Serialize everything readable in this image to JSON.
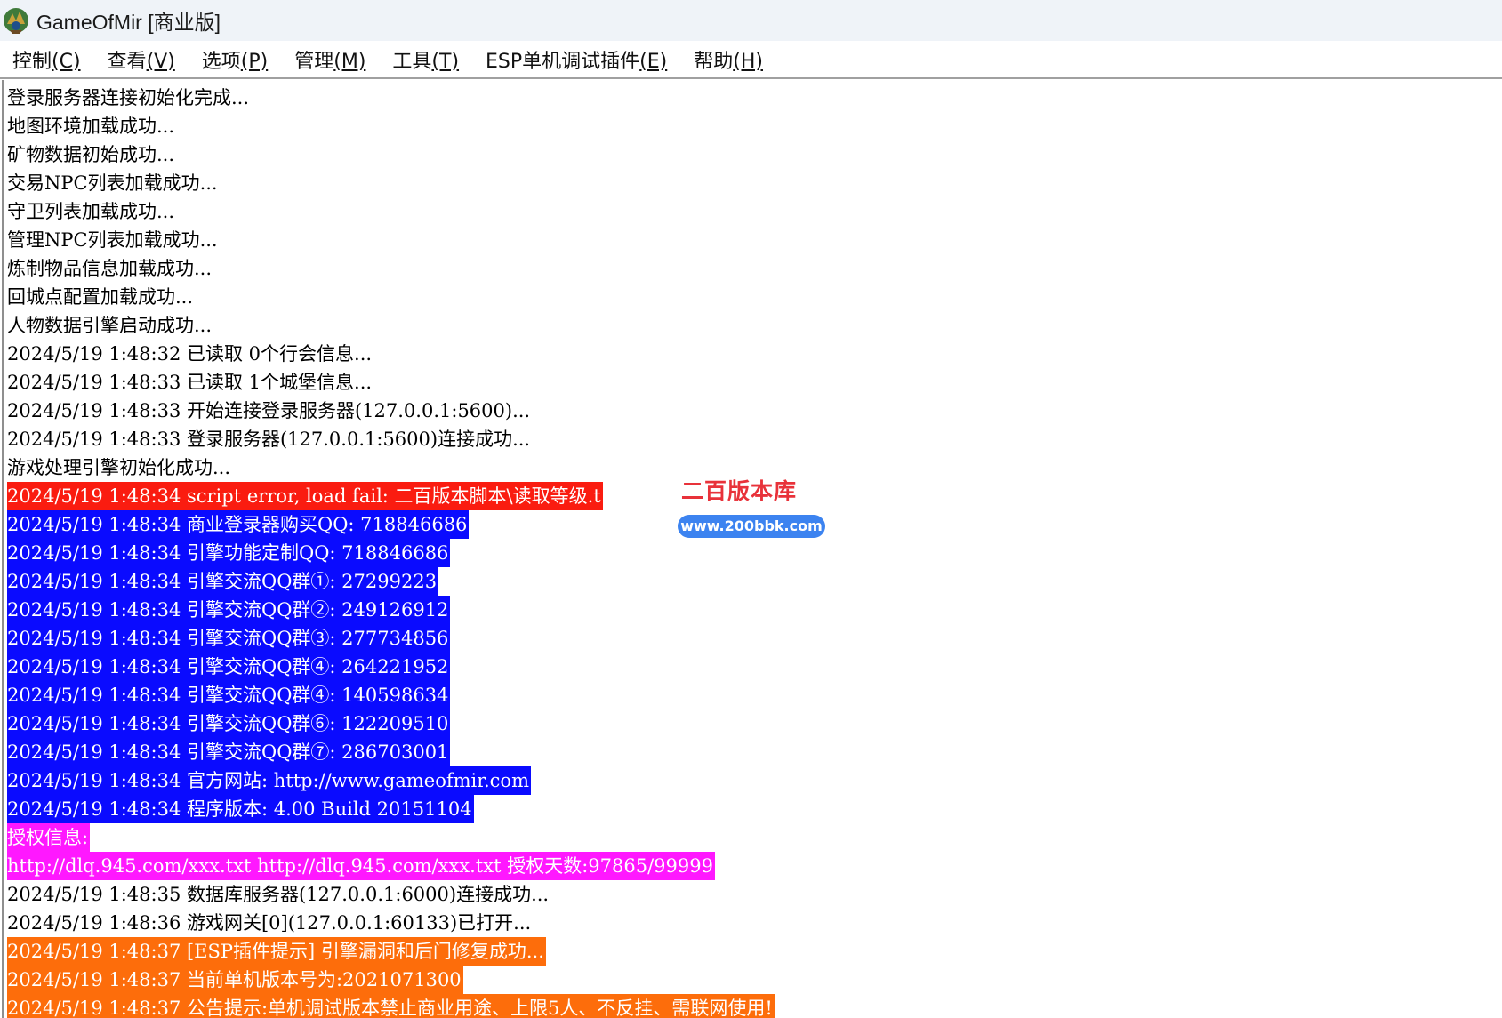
{
  "window": {
    "title": "GameOfMir [商业版]"
  },
  "menu": [
    {
      "label": "控制",
      "accel": "(C)"
    },
    {
      "label": "查看",
      "accel": "(V)"
    },
    {
      "label": "选项",
      "accel": "(P)"
    },
    {
      "label": "管理",
      "accel": "(M)"
    },
    {
      "label": "工具",
      "accel": "(T)"
    },
    {
      "label": "ESP单机调试插件",
      "accel": "(E)"
    },
    {
      "label": "帮助",
      "accel": "(H)"
    }
  ],
  "log": [
    {
      "text": "登录服务器连接初始化完成...",
      "style": "plain"
    },
    {
      "text": "地图环境加载成功...",
      "style": "plain"
    },
    {
      "text": "矿物数据初始成功...",
      "style": "plain"
    },
    {
      "text": "交易NPC列表加载成功...",
      "style": "plain"
    },
    {
      "text": "守卫列表加载成功...",
      "style": "plain"
    },
    {
      "text": "管理NPC列表加载成功...",
      "style": "plain"
    },
    {
      "text": "炼制物品信息加载成功...",
      "style": "plain"
    },
    {
      "text": "回城点配置加载成功...",
      "style": "plain"
    },
    {
      "text": "人物数据引擎启动成功...",
      "style": "plain"
    },
    {
      "text": "2024/5/19 1:48:32 已读取 0个行会信息...",
      "style": "plain"
    },
    {
      "text": "2024/5/19 1:48:33 已读取 1个城堡信息...",
      "style": "plain"
    },
    {
      "text": "2024/5/19 1:48:33 开始连接登录服务器(127.0.0.1:5600)...",
      "style": "plain"
    },
    {
      "text": "2024/5/19 1:48:33 登录服务器(127.0.0.1:5600)连接成功...",
      "style": "plain"
    },
    {
      "text": "游戏处理引擎初始化成功...",
      "style": "plain"
    },
    {
      "text": "2024/5/19 1:48:34 script error, load fail: 二百版本脚本\\读取等级.t",
      "style": "red"
    },
    {
      "text": "2024/5/19 1:48:34 商业登录器购买QQ: 718846686",
      "style": "blue"
    },
    {
      "text": "2024/5/19 1:48:34 引擎功能定制QQ: 718846686",
      "style": "blue"
    },
    {
      "text": "2024/5/19 1:48:34 引擎交流QQ群①: 27299223",
      "style": "blue"
    },
    {
      "text": "2024/5/19 1:48:34 引擎交流QQ群②: 249126912",
      "style": "blue"
    },
    {
      "text": "2024/5/19 1:48:34 引擎交流QQ群③: 277734856",
      "style": "blue"
    },
    {
      "text": "2024/5/19 1:48:34 引擎交流QQ群④: 264221952",
      "style": "blue"
    },
    {
      "text": "2024/5/19 1:48:34 引擎交流QQ群④: 140598634",
      "style": "blue"
    },
    {
      "text": "2024/5/19 1:48:34 引擎交流QQ群⑥: 122209510",
      "style": "blue"
    },
    {
      "text": "2024/5/19 1:48:34 引擎交流QQ群⑦: 286703001",
      "style": "blue"
    },
    {
      "text": "2024/5/19 1:48:34 官方网站: http://www.gameofmir.com",
      "style": "blue"
    },
    {
      "text": "2024/5/19 1:48:34 程序版本: 4.00 Build 20151104",
      "style": "blue"
    },
    {
      "text": "授权信息:    ",
      "style": "magenta"
    },
    {
      "text": "http://dlq.945.com/xxx.txt http://dlq.945.com/xxx.txt 授权天数:97865/99999",
      "style": "magenta"
    },
    {
      "text": "2024/5/19 1:48:35 数据库服务器(127.0.0.1:6000)连接成功...",
      "style": "plain"
    },
    {
      "text": "2024/5/19 1:48:36 游戏网关[0](127.0.0.1:60133)已打开...",
      "style": "plain"
    },
    {
      "text": "2024/5/19 1:48:37 [ESP插件提示] 引擎漏洞和后门修复成功...",
      "style": "orange"
    },
    {
      "text": "2024/5/19 1:48:37 当前单机版本号为:2021071300",
      "style": "orange"
    },
    {
      "text": "2024/5/19 1:48:37 公告提示:单机调试版本禁止商业用途、上限5人、不反挂、需联网使用!",
      "style": "orange"
    }
  ],
  "watermark": {
    "title": "二百版本库",
    "url": "www.200bbk.com"
  }
}
